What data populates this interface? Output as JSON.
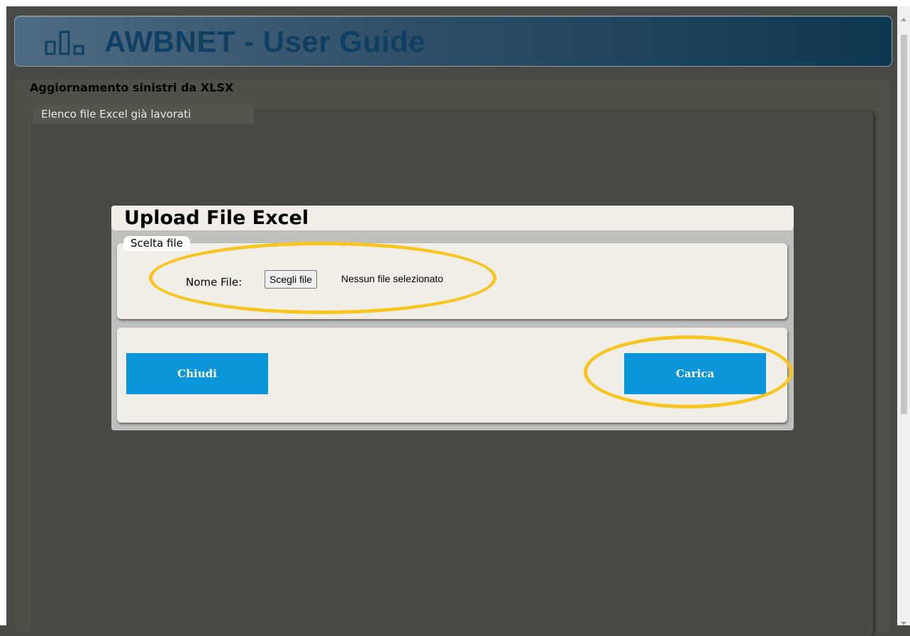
{
  "header": {
    "title": "AWBNET - User Guide",
    "logo_icon": "bar-chart-logo-icon"
  },
  "page": {
    "section_title": "Aggiornamento sinistri da XLSX",
    "panel_tab": "Elenco file Excel già lavorati"
  },
  "dialog": {
    "title": "Upload File Excel",
    "file_section": {
      "legend": "Scelta file",
      "label": "Nome File:",
      "choose_button": "Scegli file",
      "status": "Nessun file selezionato"
    },
    "buttons": {
      "close": "Chiudi",
      "upload": "Carica"
    }
  },
  "colors": {
    "accent_button": "#0a96d9",
    "highlight": "#f7c51e",
    "header_title": "#0f3f63",
    "overlay": "#4a4a45"
  }
}
